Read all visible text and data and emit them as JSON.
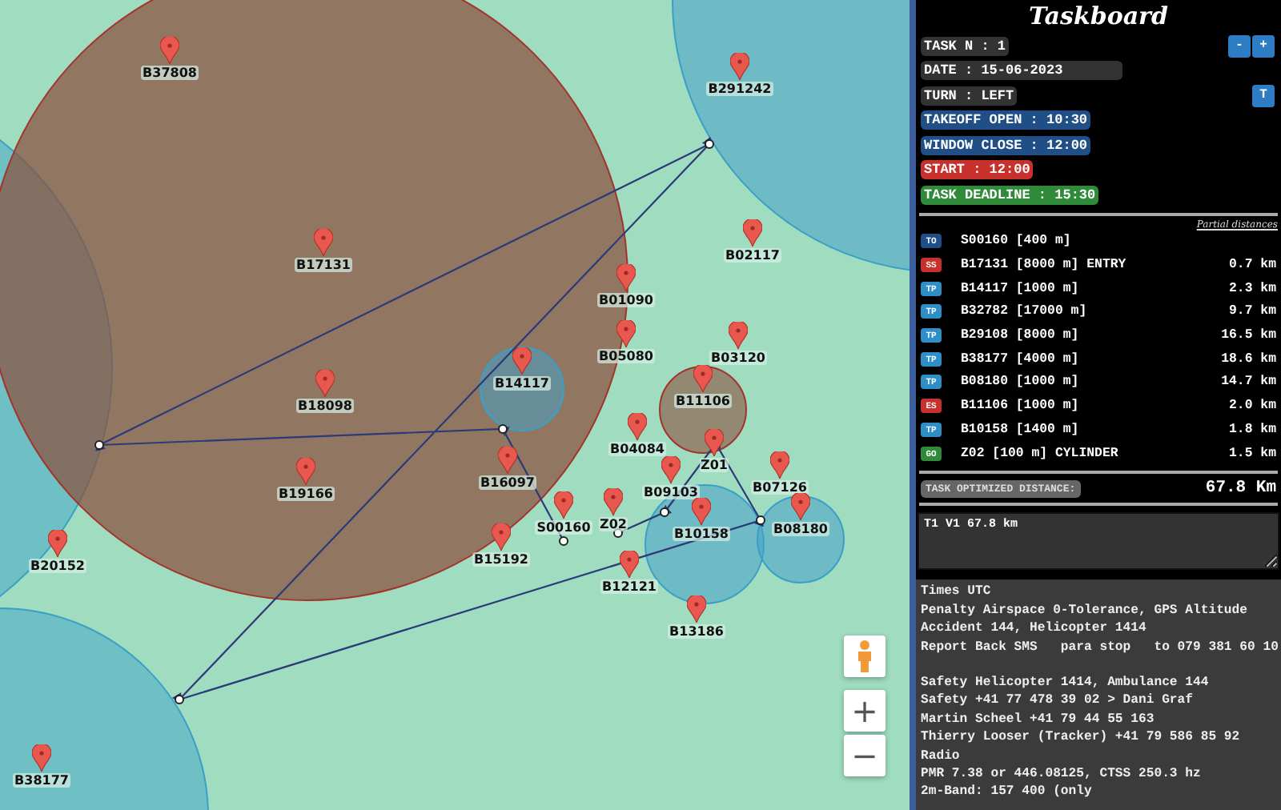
{
  "map": {
    "waypoints": [
      {
        "label": "B37808"
      },
      {
        "label": "B291242"
      },
      {
        "label": "B17131"
      },
      {
        "label": "B02117"
      },
      {
        "label": "B01090"
      },
      {
        "label": "B14117"
      },
      {
        "label": "B05080"
      },
      {
        "label": "B03120"
      },
      {
        "label": "B11106"
      },
      {
        "label": "B18098"
      },
      {
        "label": "B04084"
      },
      {
        "label": "B16097"
      },
      {
        "label": "B19166"
      },
      {
        "label": "Z01"
      },
      {
        "label": "B09103"
      },
      {
        "label": "B07126"
      },
      {
        "label": "S00160"
      },
      {
        "label": "Z02"
      },
      {
        "label": "B10158"
      },
      {
        "label": "B08180"
      },
      {
        "label": "B20152"
      },
      {
        "label": "B15192"
      },
      {
        "label": "B12121"
      },
      {
        "label": "B13186"
      },
      {
        "label": "B38177"
      }
    ],
    "zoom_in": "+",
    "zoom_out": "−"
  },
  "taskboard": {
    "title": "Taskboard",
    "fields": [
      {
        "text": "TASK N : 1",
        "color": "#333333"
      },
      {
        "text": "DATE : 15-06-2023",
        "color": "#333333"
      },
      {
        "text": "TURN : LEFT",
        "color": "#333333"
      },
      {
        "text": "TAKEOFF OPEN : 10:30",
        "color": "#1f4f86"
      },
      {
        "text": "WINDOW CLOSE : 12:00",
        "color": "#1f4f86"
      },
      {
        "text": "START : 12:00",
        "color": "#c8312b"
      },
      {
        "text": "TASK DEADLINE : 15:30",
        "color": "#2f8a3a"
      }
    ],
    "task_buttons": [
      "-",
      "+"
    ],
    "turn_button": "T",
    "partial_header": "Partial distances",
    "turnpoints": [
      {
        "type": "TO",
        "color": "#1f4f86",
        "name": "S00160 [400 m]"
      },
      {
        "type": "SS",
        "color": "#c8312b",
        "name": "B17131 [8000 m] ENTRY",
        "distance": "0.7 km"
      },
      {
        "type": "TP",
        "color": "#2e8fc8",
        "name": "B14117 [1000 m]",
        "distance": "2.3 km"
      },
      {
        "type": "TP",
        "color": "#2e8fc8",
        "name": "B32782 [17000 m]",
        "distance": "9.7 km"
      },
      {
        "type": "TP",
        "color": "#2e8fc8",
        "name": "B29108 [8000 m]",
        "distance": "16.5 km"
      },
      {
        "type": "TP",
        "color": "#2e8fc8",
        "name": "B38177 [4000 m]",
        "distance": "18.6 km"
      },
      {
        "type": "TP",
        "color": "#2e8fc8",
        "name": "B08180 [1000 m]",
        "distance": "14.7 km"
      },
      {
        "type": "ES",
        "color": "#c8312b",
        "name": "B11106 [1000 m]",
        "distance": "2.0 km"
      },
      {
        "type": "TP",
        "color": "#2e8fc8",
        "name": "B10158 [1400 m]",
        "distance": "1.8 km"
      },
      {
        "type": "GO",
        "color": "#2f8a3a",
        "name": "Z02 [100 m] CYLINDER",
        "distance": "1.5 km"
      }
    ],
    "optimized_label": "TASK OPTIMIZED DISTANCE:",
    "optimized_value": "67.8 Km",
    "task_note": "T1 V1 67.8 km",
    "notes": [
      [
        "Times UTC",
        "Penalty Airspace 0-Tolerance, GPS Altitude",
        "Accident 144, Helicopter 1414",
        "Report Back SMS   para stop   to 079 381 60 10"
      ],
      [
        "Safety Helicopter 1414, Ambulance 144",
        "Safety +41 77 478 39 02 > Dani Graf",
        "Martin Scheel +41 79 44 55 163",
        "Thierry Looser (Tracker) +41 79 586 85 92",
        "Radio",
        "PMR 7.38 or 446.08125, CTSS 250.3 hz",
        "2m-Band: 157 400 (only"
      ]
    ]
  }
}
